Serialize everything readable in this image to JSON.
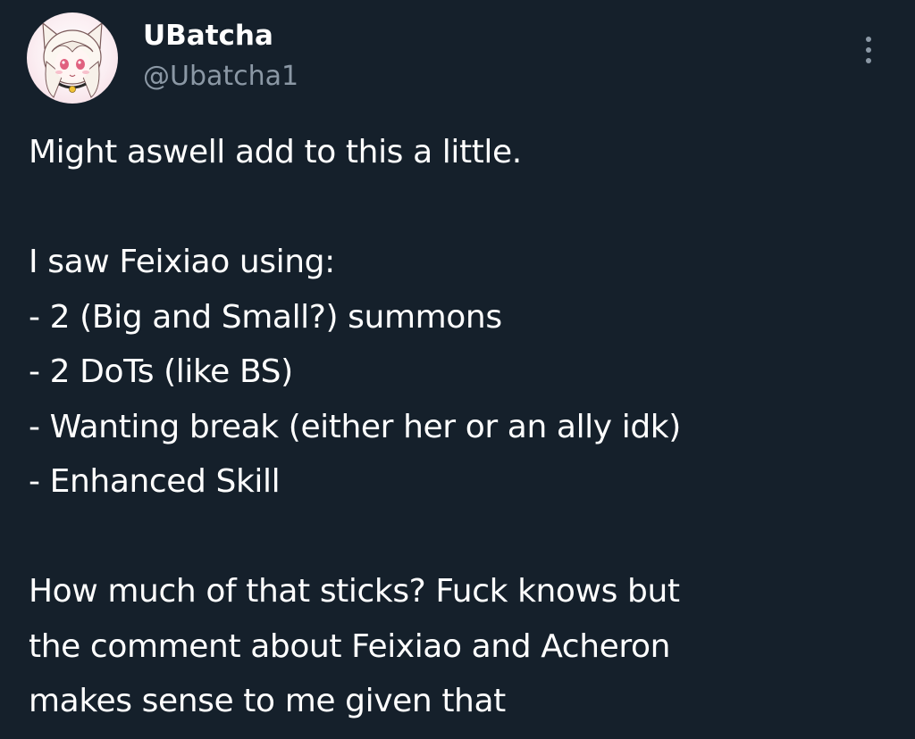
{
  "author": {
    "display_name": "UBatcha",
    "handle": "@Ubatcha1"
  },
  "more_options": {
    "icon": "more-vertical-icon"
  },
  "post": {
    "lines": [
      "Might aswell add to this a little.",
      "",
      "I saw Feixiao using:",
      "- 2 (Big and Small?) summons",
      "- 2 DoTs (like BS)",
      "- Wanting break (either her or an ally idk)",
      "- Enhanced Skill",
      "",
      "How much of that sticks? Fuck knows but",
      "the comment about Feixiao and Acheron",
      "makes sense to me given that"
    ]
  },
  "colors": {
    "background": "#15202b",
    "text_primary": "#ffffff",
    "text_secondary": "#8b98a5"
  }
}
